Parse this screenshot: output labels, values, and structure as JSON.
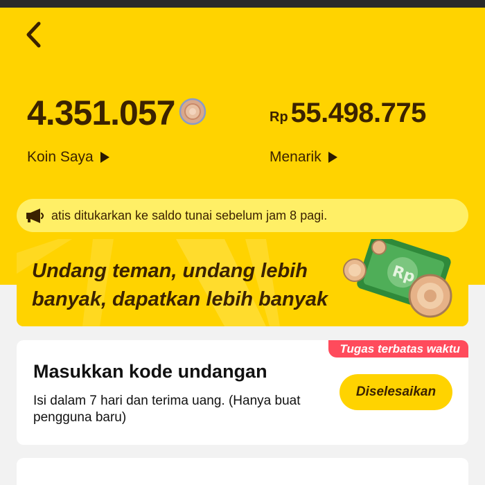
{
  "header": {
    "back_icon": "chevron-left-icon",
    "colors": {
      "background": "#ffd300",
      "text": "#3b2200"
    }
  },
  "coins": {
    "value": "4.351.057",
    "icon": "coin-icon",
    "link_label": "Koin Saya"
  },
  "withdraw": {
    "currency": "Rp",
    "value": "55.498.775",
    "link_label": "Menarik"
  },
  "notice": {
    "icon": "megaphone-icon",
    "text": "atis ditukarkan ke saldo tunai sebelum jam 8 pagi."
  },
  "banner": {
    "line1": "Undang teman, undang lebih",
    "line2": "banyak, dapatkan lebih banyak",
    "art_text": "Rp"
  },
  "task_card": {
    "badge": "Tugas terbatas waktu",
    "title": "Masukkan kode undangan",
    "description": "Isi dalam 7 hari dan terima uang. (Hanya buat pengguna baru)",
    "button_label": "Diselesaikan",
    "badge_color": "#ff4b5c"
  }
}
